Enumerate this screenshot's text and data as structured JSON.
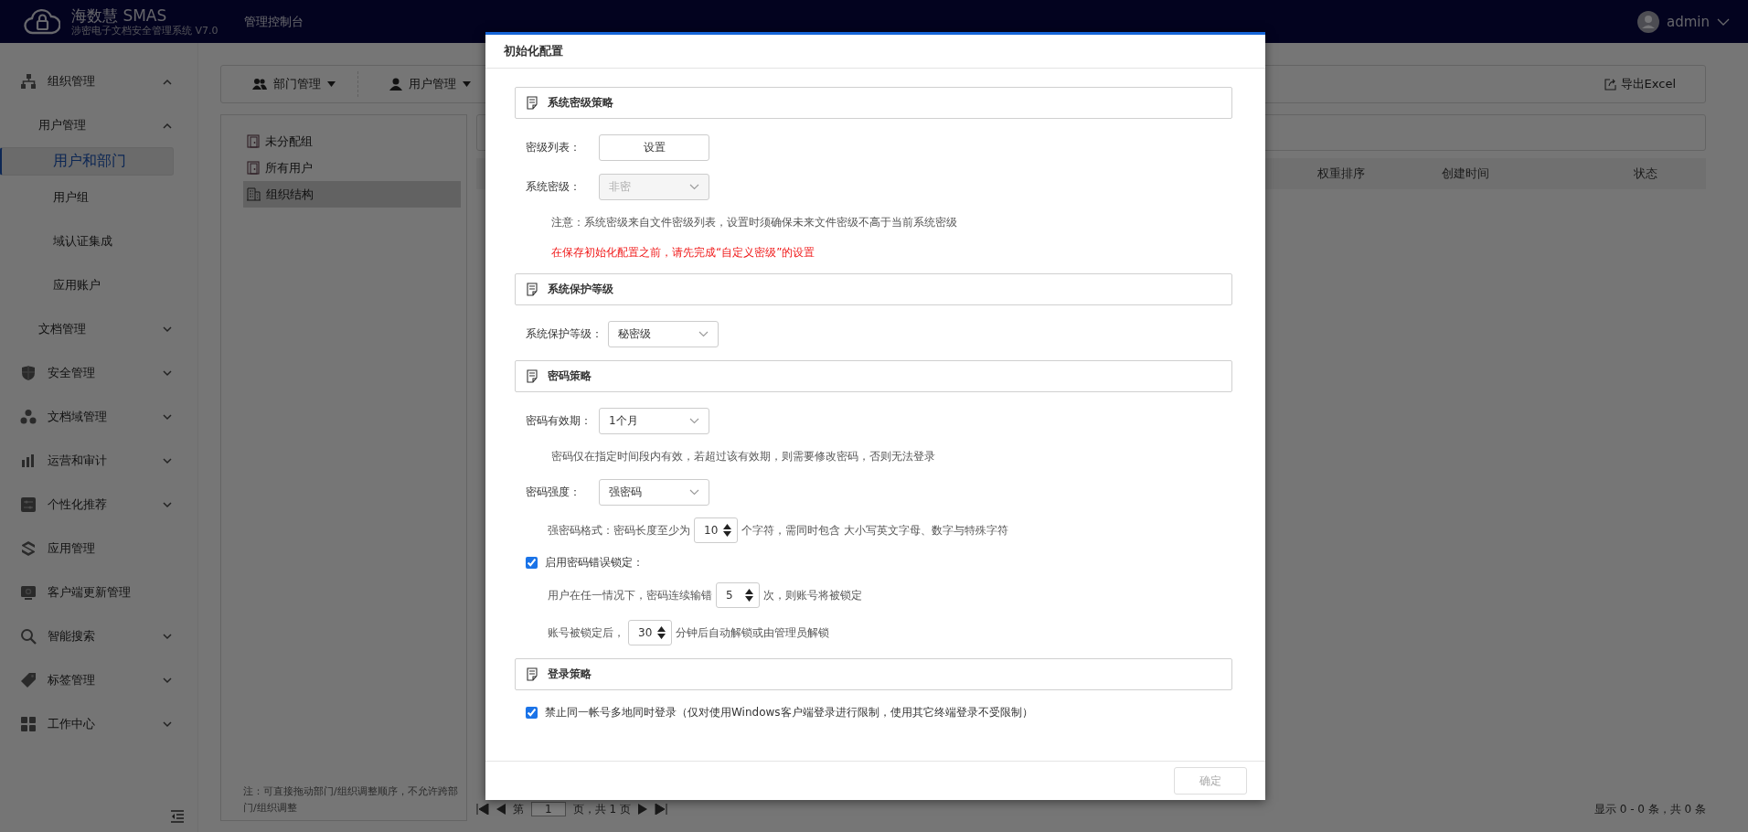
{
  "header": {
    "brand": "海数慧 SMAS",
    "subtitle": "涉密电子文档安全管理系统 V7.0",
    "console_title": "管理控制台",
    "user": "admin"
  },
  "sidebar": {
    "items": [
      {
        "label": "组织管理",
        "expanded": true,
        "children": [
          {
            "label": "用户管理",
            "expanded": true,
            "children": [
              {
                "label": "用户和部门",
                "selected": true
              },
              {
                "label": "用户组",
                "selected": false
              },
              {
                "label": "域认证集成",
                "selected": false
              },
              {
                "label": "应用账户",
                "selected": false
              }
            ]
          },
          {
            "label": "文档管理",
            "expanded": false
          }
        ]
      },
      {
        "label": "安全管理",
        "expanded": false
      },
      {
        "label": "文档域管理",
        "expanded": false
      },
      {
        "label": "运营和审计",
        "expanded": false
      },
      {
        "label": "个性化推荐",
        "expanded": false
      },
      {
        "label": "应用管理"
      },
      {
        "label": "客户端更新管理"
      },
      {
        "label": "智能搜索",
        "expanded": false
      },
      {
        "label": "标签管理",
        "expanded": false
      },
      {
        "label": "工作中心",
        "expanded": false
      }
    ]
  },
  "toolbar": {
    "menus": [
      "部门管理",
      "用户管理"
    ],
    "export": "导出Excel"
  },
  "tree": {
    "items": [
      {
        "label": "未分配组",
        "selected": false
      },
      {
        "label": "所有用户",
        "selected": false
      },
      {
        "label": "组织结构",
        "selected": true
      }
    ],
    "note": "注：可直接拖动部门/组织调整顺序，不允许跨部门/组织调整"
  },
  "table": {
    "columns": [
      "权重排序",
      "创建时间",
      "状态"
    ]
  },
  "pagination": {
    "prefix": "第",
    "page": "1",
    "suffix": "页，共 1 页",
    "summary": "显示 0 - 0 条，共 0 条"
  },
  "dialog": {
    "title": "初始化配置",
    "sections": [
      {
        "title": "系统密级策略",
        "rows": [
          {
            "kind": "button",
            "label": "密级列表：",
            "button": "设置"
          },
          {
            "kind": "select",
            "label": "系统密级：",
            "value": "非密",
            "disabled": true
          },
          {
            "kind": "note",
            "text": "注意：系统密级来自文件密级列表，设置时须确保未来文件密级不高于当前系统密级"
          },
          {
            "kind": "warning",
            "text": "在保存初始化配置之前，请先完成“自定义密级”的设置"
          }
        ]
      },
      {
        "title": "系统保护等级",
        "rows": [
          {
            "kind": "select",
            "label": "系统保护等级：",
            "value": "秘密级",
            "disabled": false
          }
        ]
      },
      {
        "title": "密码策略",
        "rows": [
          {
            "kind": "select",
            "label": "密码有效期：",
            "value": "1个月",
            "disabled": false
          },
          {
            "kind": "note",
            "text": "密码仅在指定时间段内有效，若超过该有效期，则需要修改密码，否则无法登录"
          },
          {
            "kind": "select",
            "label": "密码强度：",
            "value": "强密码",
            "disabled": false
          },
          {
            "kind": "stepper",
            "before": "强密码格式：密码长度至少为",
            "value": "10",
            "after": "个字符，需同时包含 大小写英文字母、数字与特殊字符"
          },
          {
            "kind": "checkbox",
            "label": "启用密码错误锁定：",
            "checked": true
          },
          {
            "kind": "stepper",
            "before": "用户在任一情况下，密码连续输错",
            "value": "5",
            "after": "次，则账号将被锁定"
          },
          {
            "kind": "stepper",
            "before": "账号被锁定后，",
            "value": "30",
            "after": "分钟后自动解锁或由管理员解锁"
          }
        ]
      },
      {
        "title": "登录策略",
        "rows": [
          {
            "kind": "checkbox",
            "label": "禁止同一帐号多地同时登录（仅对使用Windows客户端登录进行限制，使用其它终端登录不受限制）",
            "checked": true
          }
        ]
      }
    ],
    "confirm": {
      "label": "确定",
      "disabled": true
    }
  }
}
